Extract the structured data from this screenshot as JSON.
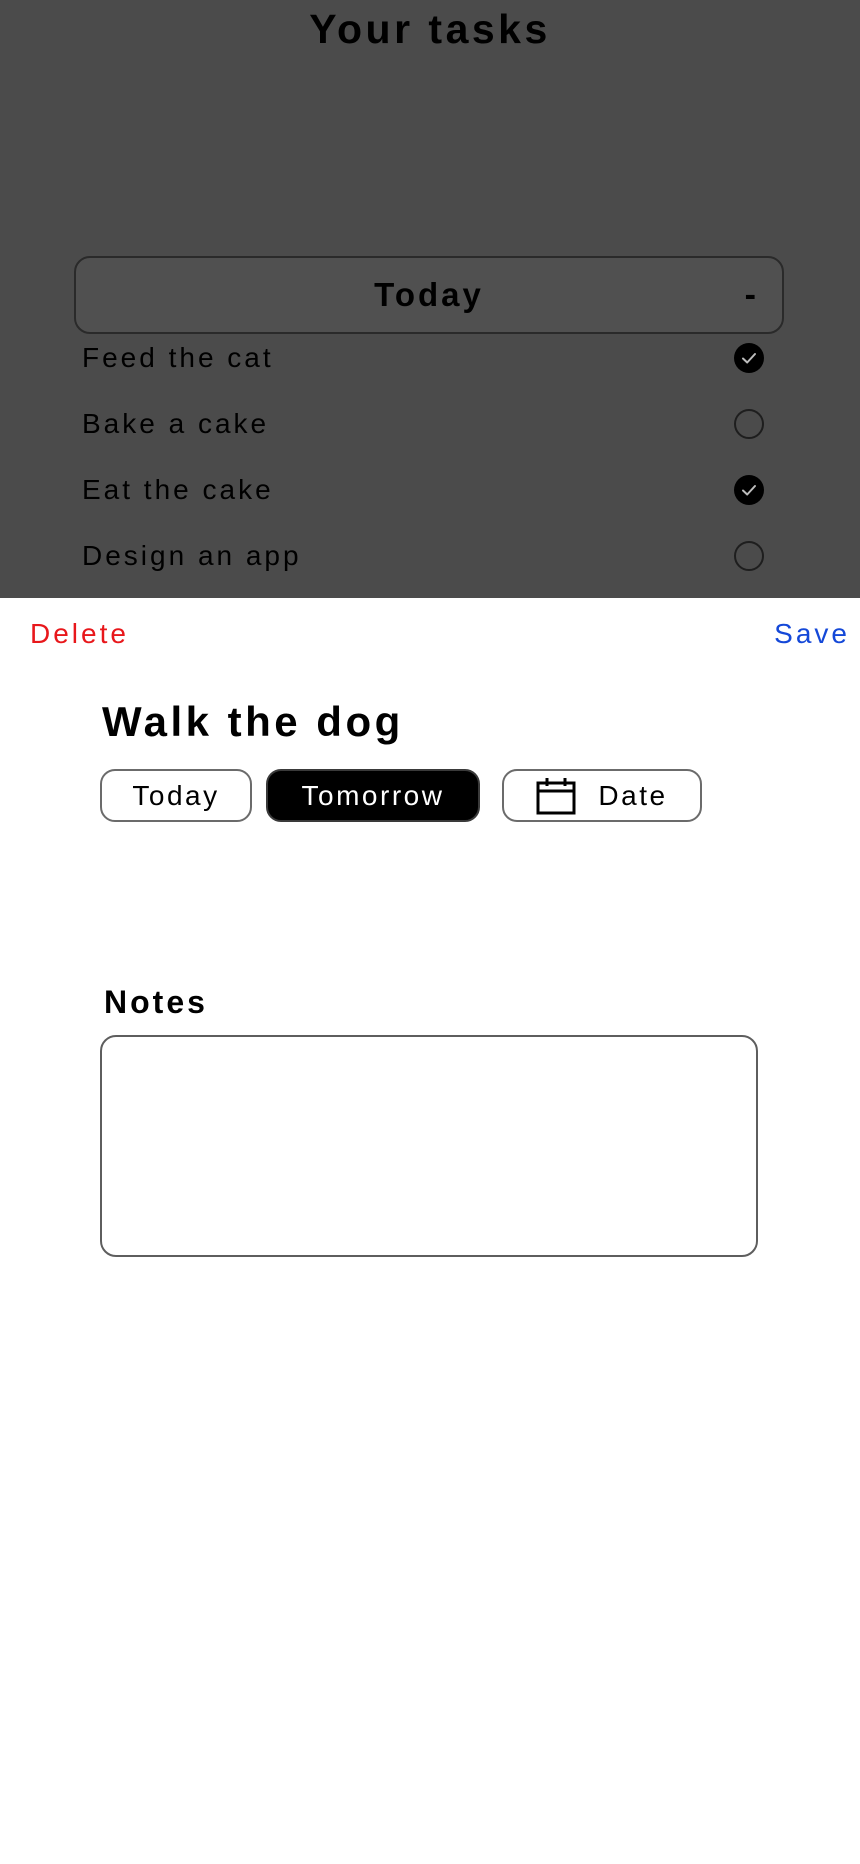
{
  "background_screen": {
    "title": "Your tasks",
    "section": {
      "title": "Today",
      "collapse_label": "-"
    },
    "tasks": [
      {
        "label": "Feed the cat",
        "done": true
      },
      {
        "label": "Bake a cake",
        "done": false
      },
      {
        "label": "Eat the cake",
        "done": true
      },
      {
        "label": "Design an app",
        "done": false
      }
    ]
  },
  "sheet": {
    "delete_label": "Delete",
    "save_label": "Save",
    "task_name": "Walk the dog",
    "date_options": {
      "today": "Today",
      "tomorrow": "Tomorrow",
      "date": "Date",
      "selected": "Tomorrow",
      "date_icon": "calendar-icon"
    },
    "notes": {
      "label": "Notes",
      "value": ""
    }
  },
  "colors": {
    "delete": "#e8171b",
    "save": "#1448d8",
    "overlay": "#4b4b4b",
    "selected_chip": "#000000"
  }
}
